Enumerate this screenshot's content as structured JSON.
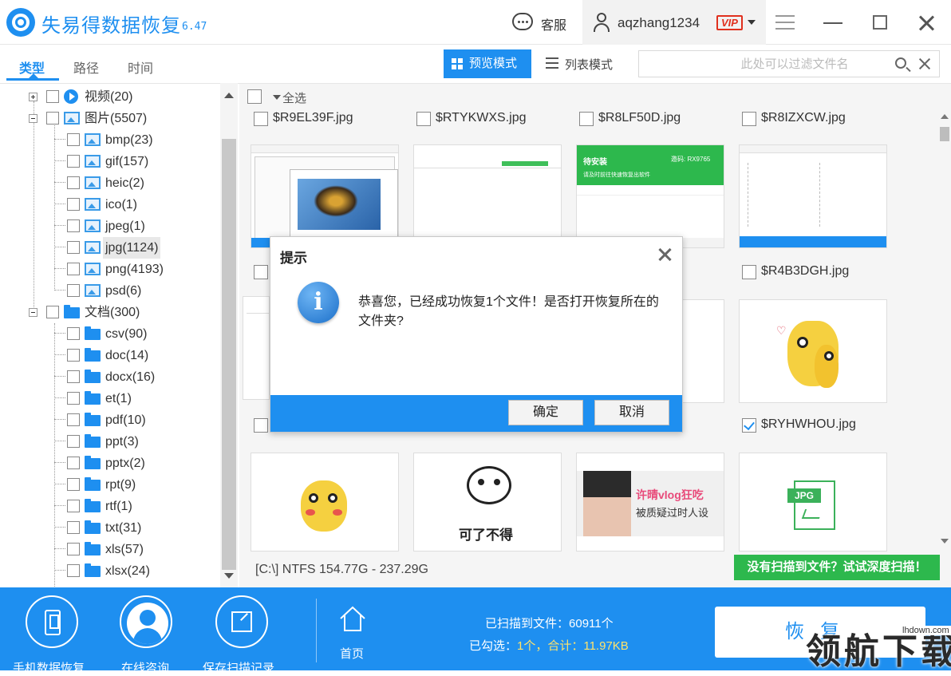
{
  "app": {
    "title": "失易得数据恢复",
    "version": "6.47"
  },
  "header": {
    "service_label": "客服",
    "username": "aqzhang1234",
    "vip_badge": "VIP"
  },
  "tabs": [
    {
      "label": "类型",
      "active": true
    },
    {
      "label": "路径",
      "active": false
    },
    {
      "label": "时间",
      "active": false
    }
  ],
  "view_modes": {
    "preview": "预览模式",
    "list": "列表模式"
  },
  "filter": {
    "placeholder": "此处可以过滤文件名",
    "value": ""
  },
  "tree": {
    "categories": [
      {
        "label": "视频(20)",
        "icon": "video-icon",
        "expanded": false
      },
      {
        "label": "图片(5507)",
        "icon": "image-icon",
        "expanded": true,
        "children": [
          "bmp(23)",
          "gif(157)",
          "heic(2)",
          "ico(1)",
          "jpeg(1)",
          "jpg(1124)",
          "png(4193)",
          "psd(6)"
        ]
      },
      {
        "label": "文档(300)",
        "icon": "folder-icon",
        "expanded": true,
        "children": [
          "csv(90)",
          "doc(14)",
          "docx(16)",
          "et(1)",
          "pdf(10)",
          "ppt(3)",
          "pptx(2)",
          "rpt(9)",
          "rtf(1)",
          "txt(31)",
          "xls(57)",
          "xlsx(24)"
        ]
      }
    ],
    "selected": "jpg(1124)"
  },
  "grid": {
    "select_all_label": "全选",
    "row1": [
      "$R9EL39F.jpg",
      "$RTYKWXS.jpg",
      "$R8LF50D.jpg",
      "$R8IZXCW.jpg"
    ],
    "row2": [
      "$R4B3DGH.jpg"
    ],
    "row3_visible": [
      "$RYHWHOU.jpg"
    ],
    "row3_partial_suffix": "jpg",
    "thumb_texts": {
      "install_title": "待安装",
      "install_code": "邀码: RX9765",
      "install_sub": "请及时前往快速恢复出软件",
      "meme_caption": "可了不得",
      "vlog_title": "许晴vlog狂吃",
      "vlog_sub": "被质疑过时人设",
      "jpg_badge": "JPG"
    }
  },
  "status": {
    "disk_info": "[C:\\] NTFS 154.77G - 237.29G",
    "deep_scan_label": "没有扫描到文件？试试深度扫描！"
  },
  "dialog": {
    "title": "提示",
    "message": "恭喜您，已经成功恢复1个文件！是否打开恢复所在的文件夹?",
    "confirm": "确定",
    "cancel": "取消"
  },
  "bottom": {
    "phone_recovery": "手机数据恢复",
    "online_consult": "在线咨询",
    "save_scan": "保存扫描记录",
    "home": "首页",
    "scanned_label": "已扫描到文件：",
    "scanned_value": "60911个",
    "selected_label": "已勾选：",
    "selected_value": "1个，合计：11.97KB",
    "recover_button": "恢复"
  },
  "watermark": {
    "text": "领航下载",
    "url": "lhdown.com"
  },
  "colors": {
    "accent": "#1e8ff0",
    "green": "#2db84d",
    "vip": "#e0301e"
  }
}
